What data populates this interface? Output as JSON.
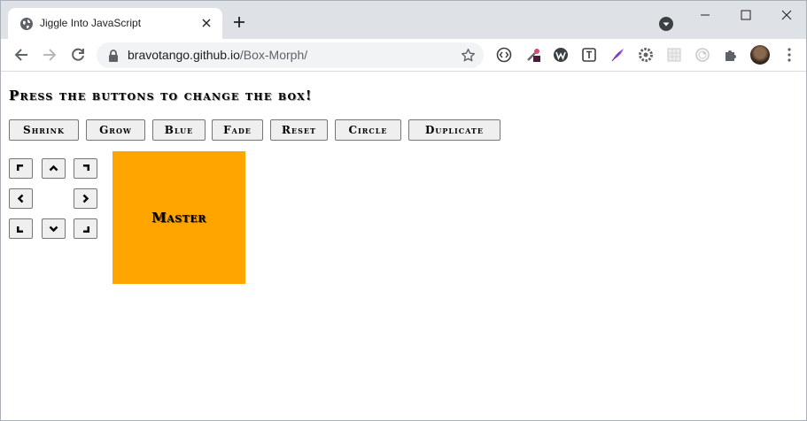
{
  "browser": {
    "tab_title": "Jiggle Into JavaScript",
    "url_host": "bravotango.github.io",
    "url_path": "/Box-Morph/"
  },
  "page": {
    "headline": "Press the buttons to change the box!",
    "buttons": [
      "Shrink",
      "Grow",
      "Blue",
      "Fade",
      "Reset",
      "Circle",
      "Duplicate"
    ],
    "box_label": "Master"
  },
  "colors": {
    "box": "#ffa500",
    "chrome": "#dee1e6"
  },
  "icons": {
    "direction_pad": [
      "arrow-up-left-icon",
      "arrow-up-icon",
      "arrow-up-right-icon",
      "arrow-left-icon",
      "arrow-right-icon",
      "arrow-down-left-icon",
      "arrow-down-icon",
      "arrow-down-right-icon"
    ]
  }
}
